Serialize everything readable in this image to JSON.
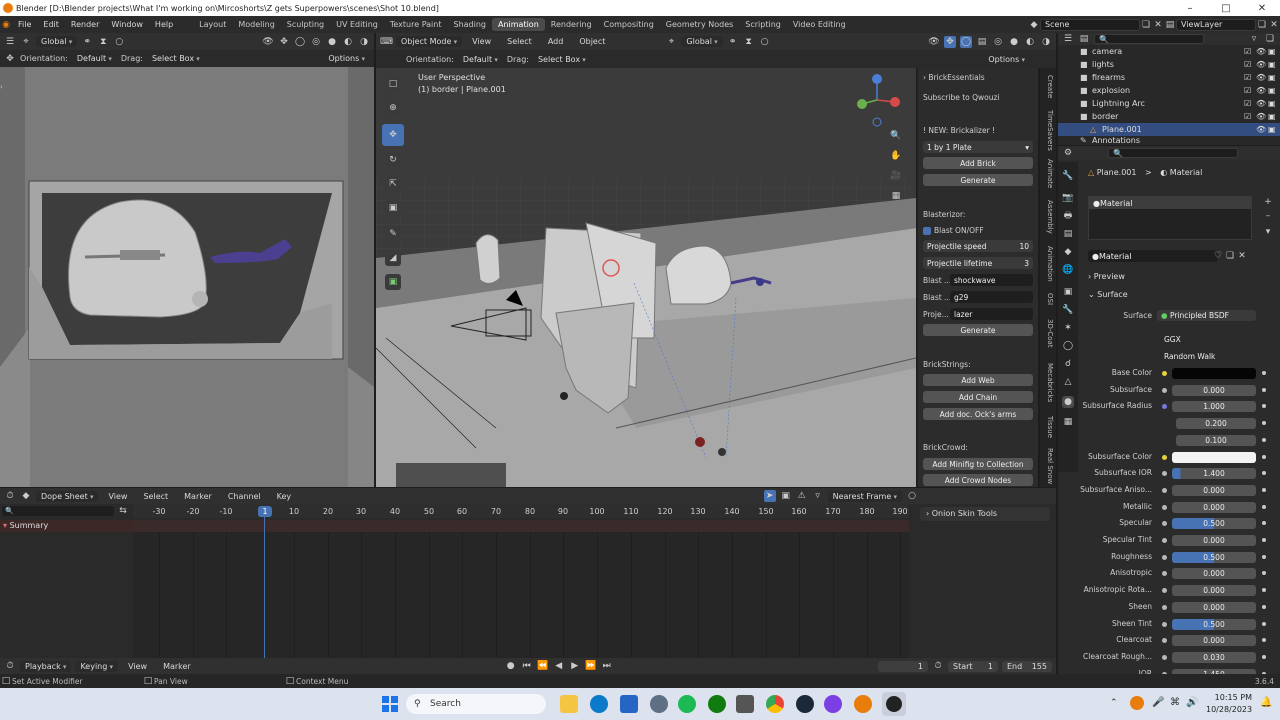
{
  "window": {
    "title": "Blender [D:\\Blender projects\\What I'm working on\\Mircoshorts\\Z gets Superpowers\\scenes\\Shot 10.blend]"
  },
  "menubar": {
    "menus": [
      "File",
      "Edit",
      "Render",
      "Window",
      "Help"
    ],
    "workspaces": [
      "Layout",
      "Modeling",
      "Sculpting",
      "UV Editing",
      "Texture Paint",
      "Shading",
      "Animation",
      "Rendering",
      "Compositing",
      "Geometry Nodes",
      "Scripting",
      "Video Editing"
    ],
    "active_workspace": "Animation",
    "scene": "Scene",
    "view_layer": "ViewLayer"
  },
  "left_viewport": {
    "orientation_label": "Global",
    "orientation_row_label": "Orientation:",
    "orientation_value": "Default",
    "drag_label": "Drag:",
    "drag_value": "Select Box",
    "options": "Options"
  },
  "main_viewport": {
    "mode": "Object Mode",
    "menus": [
      "View",
      "Select",
      "Add",
      "Object"
    ],
    "transform": "Global",
    "orientation_row_label": "Orientation:",
    "orientation_value": "Default",
    "drag_label": "Drag:",
    "drag_value": "Select Box",
    "options": "Options",
    "perspective": "User Perspective",
    "selection": "(1) border | Plane.001"
  },
  "npanel": {
    "title": "BrickEssentials",
    "subscribe": "Subscribe to Qwouzi",
    "new_label": "! NEW: Brickalizer !",
    "brick_type": "1 by 1 Plate",
    "add_brick": "Add Brick",
    "generate": "Generate",
    "blasterizor": "Blasterizor:",
    "blast_toggle": "Blast ON/OFF",
    "projectile_speed_label": "Projectile speed",
    "projectile_speed": "10",
    "projectile_lifetime_label": "Projectile lifetime",
    "projectile_lifetime": "3",
    "blast_label_1": "Blast ...",
    "blast_value_1": "shockwave",
    "blast_label_2": "Blast ...",
    "blast_value_2": "g29",
    "proj_label": "Proje...",
    "proj_value": "lazer",
    "generate2": "Generate",
    "brickstrings": "BrickStrings:",
    "add_web": "Add Web",
    "add_chain": "Add Chain",
    "add_ock": "Add doc. Ock's arms",
    "brickcrowd": "BrickCrowd:",
    "add_minifig": "Add Minifig to Collection",
    "add_crowd": "Add Crowd Nodes",
    "tabs": [
      "Create",
      "TimeSavers",
      "Animate",
      "Assembly",
      "Animation",
      "OSI",
      "3D-Coat",
      "Mecabricks",
      "Tissue",
      "Real Snow"
    ]
  },
  "outliner": {
    "items": [
      {
        "name": "camera",
        "indent": 1
      },
      {
        "name": "lights",
        "indent": 1
      },
      {
        "name": "firearms",
        "indent": 1
      },
      {
        "name": "explosion",
        "indent": 1
      },
      {
        "name": "Lightning Arc",
        "indent": 1
      },
      {
        "name": "border",
        "indent": 1
      },
      {
        "name": "Plane.001",
        "indent": 2
      },
      {
        "name": "Annotations",
        "indent": 1
      }
    ]
  },
  "properties": {
    "breadcrumb_object": "Plane.001",
    "breadcrumb_sep": ">",
    "breadcrumb_material": "Material",
    "slot": "Material",
    "material_name": "Material",
    "preview": "Preview",
    "surface_section": "Surface",
    "surface_label": "Surface",
    "surface_value": "Principled BSDF",
    "distribution": "GGX",
    "subsurface_method": "Random Walk",
    "rows": [
      {
        "label": "Base Color",
        "value": "",
        "kind": "black"
      },
      {
        "label": "Subsurface",
        "value": "0.000",
        "kind": "plain"
      },
      {
        "label": "Subsurface Radius",
        "value": "1.000",
        "kind": "plain"
      },
      {
        "label": "",
        "value": "0.200",
        "kind": "plain"
      },
      {
        "label": "",
        "value": "0.100",
        "kind": "plain"
      },
      {
        "label": "Subsurface Color",
        "value": "",
        "kind": "white"
      },
      {
        "label": "Subsurface IOR",
        "value": "1.400",
        "kind": "blue-small"
      },
      {
        "label": "Subsurface Aniso...",
        "value": "0.000",
        "kind": "plain"
      },
      {
        "label": "Metallic",
        "value": "0.000",
        "kind": "plain"
      },
      {
        "label": "Specular",
        "value": "0.500",
        "kind": "blue"
      },
      {
        "label": "Specular Tint",
        "value": "0.000",
        "kind": "plain"
      },
      {
        "label": "Roughness",
        "value": "0.500",
        "kind": "blue"
      },
      {
        "label": "Anisotropic",
        "value": "0.000",
        "kind": "plain"
      },
      {
        "label": "Anisotropic Rota...",
        "value": "0.000",
        "kind": "plain"
      },
      {
        "label": "Sheen",
        "value": "0.000",
        "kind": "plain"
      },
      {
        "label": "Sheen Tint",
        "value": "0.500",
        "kind": "blue"
      },
      {
        "label": "Clearcoat",
        "value": "0.000",
        "kind": "plain"
      },
      {
        "label": "Clearcoat Rough...",
        "value": "0.030",
        "kind": "plain"
      },
      {
        "label": "IOR",
        "value": "1.450",
        "kind": "plain"
      }
    ]
  },
  "dopesheet": {
    "mode": "Dope Sheet",
    "menus": [
      "View",
      "Select",
      "Marker",
      "Channel",
      "Key"
    ],
    "snap": "Nearest Frame",
    "summary": "Summary",
    "onion": "Onion Skin Tools",
    "ticks": [
      "-30",
      "-20",
      "-10",
      "1",
      "10",
      "20",
      "30",
      "40",
      "50",
      "60",
      "70",
      "80",
      "90",
      "100",
      "110",
      "120",
      "130",
      "140",
      "150",
      "160",
      "170",
      "180",
      "190"
    ],
    "current_frame": "1"
  },
  "timeline": {
    "menus": [
      "Playback",
      "Keying",
      "View",
      "Marker"
    ],
    "frame": "1",
    "start_label": "Start",
    "start": "1",
    "end_label": "End",
    "end": "155"
  },
  "statusbar": {
    "left": "Set Active Modifier",
    "mid": "Pan View",
    "right": "Context Menu",
    "version": "3.6.4"
  },
  "taskbar": {
    "search": "Search",
    "time": "10:15 PM",
    "date": "10/28/2023"
  },
  "colors": {
    "accent": "#4772b3",
    "orange": "#e87d0d",
    "bg": "#1d1d1d"
  }
}
